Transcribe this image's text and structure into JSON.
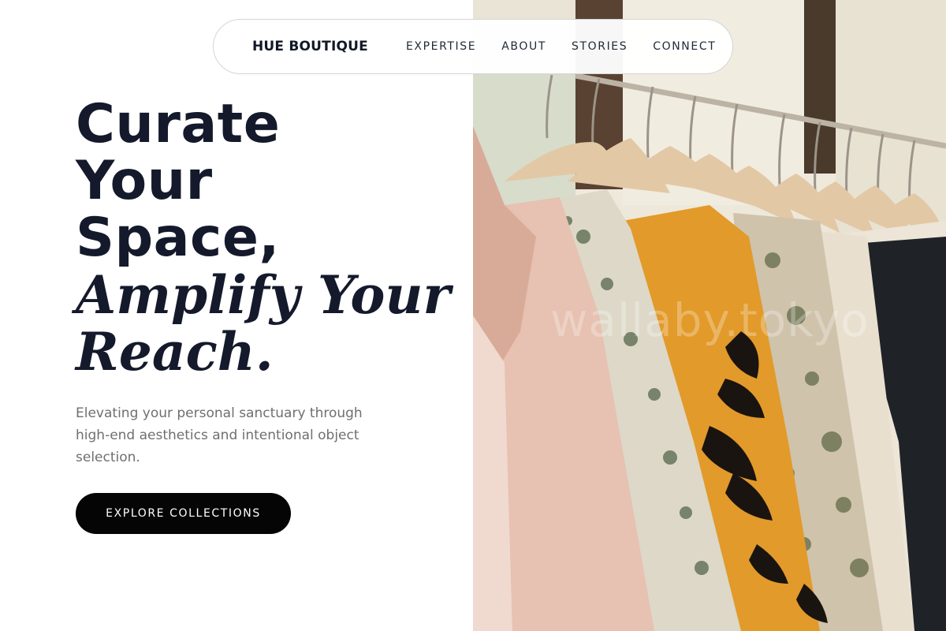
{
  "nav": {
    "brand": "HUE BOUTIQUE",
    "links": [
      "EXPERTISE",
      "ABOUT",
      "STORIES",
      "CONNECT"
    ]
  },
  "hero": {
    "headline_lines": [
      "Curate",
      "Your",
      "Space,"
    ],
    "headline_italic_lines": [
      "Amplify Your",
      "Reach."
    ],
    "subtext": "Elevating your personal sanctuary through high-end aesthetics and intentional object selection.",
    "cta_label": "EXPLORE COLLECTIONS",
    "image_watermark": "wallaby.tokyo"
  },
  "colors": {
    "text": "#141a2b",
    "subtext": "#6f6f6f",
    "button_bg": "#050505",
    "button_text": "#ffffff",
    "nav_border": "#d5d5d5",
    "accent_orange": "#e29a2a"
  }
}
